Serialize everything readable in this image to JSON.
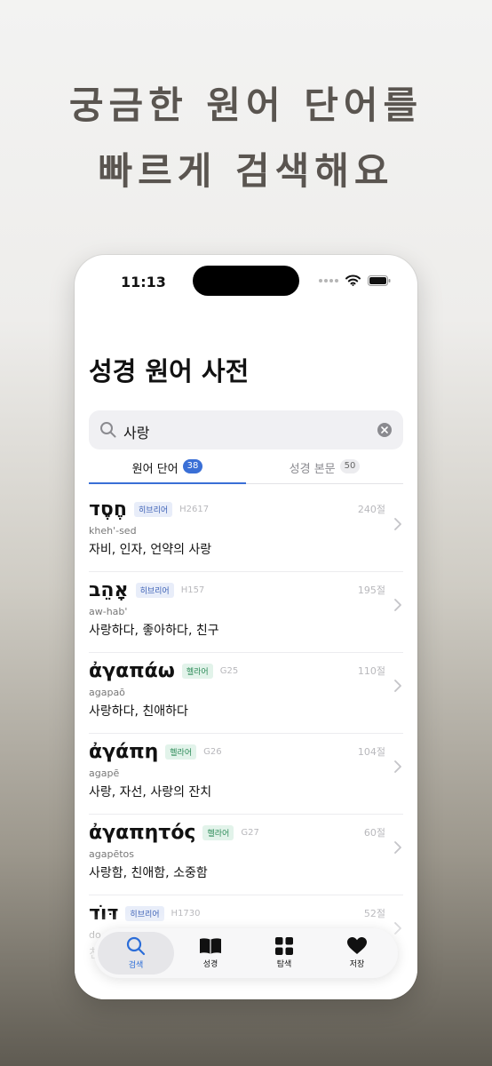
{
  "headline": {
    "line1": "궁금한 원어 단어를",
    "line2": "빠르게 검색해요"
  },
  "status": {
    "time": "11:13"
  },
  "page": {
    "title": "성경 원어 사전"
  },
  "search": {
    "value": "사랑"
  },
  "tabs": [
    {
      "label": "원어 단어",
      "count": "38"
    },
    {
      "label": "성경 본문",
      "count": "50"
    }
  ],
  "results": [
    {
      "word": "חֶסֶד",
      "lang": "히브리어",
      "strong": "H2617",
      "count": "240절",
      "translit": "kheh'-sed",
      "meaning": "자비, 인자, 언약의 사랑"
    },
    {
      "word": "אָהֵב",
      "lang": "히브리어",
      "strong": "H157",
      "count": "195절",
      "translit": "aw-hab'",
      "meaning": "사랑하다, 좋아하다, 친구"
    },
    {
      "word": "ἀγαπάω",
      "lang": "헬라어",
      "strong": "G25",
      "count": "110절",
      "translit": "agapaō",
      "meaning": "사랑하다, 친애하다"
    },
    {
      "word": "ἀγάπη",
      "lang": "헬라어",
      "strong": "G26",
      "count": "104절",
      "translit": "agapē",
      "meaning": "사랑, 자선, 사랑의 잔치"
    },
    {
      "word": "ἀγαπητός",
      "lang": "헬라어",
      "strong": "G27",
      "count": "60절",
      "translit": "agapētos",
      "meaning": "사랑함, 친애함, 소중함"
    },
    {
      "word": "דּוֹד",
      "lang": "히브리어",
      "strong": "H1730",
      "count": "52절",
      "translit": "do",
      "meaning": "친"
    }
  ],
  "tabbar": [
    {
      "label": "검색",
      "icon": "search-icon"
    },
    {
      "label": "성경",
      "icon": "book-icon"
    },
    {
      "label": "탐색",
      "icon": "grid-icon"
    },
    {
      "label": "저장",
      "icon": "heart-icon"
    }
  ],
  "colors": {
    "accent": "#3a6fd6",
    "hebrew_tag": "#3a5fb5",
    "greek_tag": "#2b8a57"
  }
}
